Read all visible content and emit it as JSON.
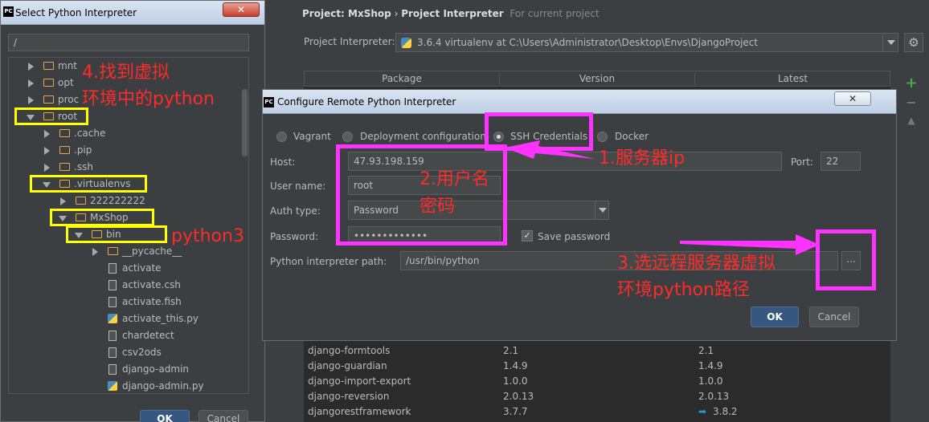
{
  "settings": {
    "breadcrumb": {
      "project": "Project: MxShop",
      "separator": "›",
      "page": "Project Interpreter",
      "scope": "For current project"
    },
    "interpreter_label": "Project Interpreter:",
    "interpreter_value": "3.6.4 virtualenv at C:\\Users\\Administrator\\Desktop\\Envs\\DjangoProject",
    "gear_icon": "⚙",
    "columns": {
      "package": "Package",
      "version": "Version",
      "latest": "Latest"
    },
    "packages": [
      {
        "name": "django-formtools",
        "version": "2.1",
        "latest": "2.1",
        "upgrade": false
      },
      {
        "name": "django-guardian",
        "version": "1.4.9",
        "latest": "1.4.9",
        "upgrade": false
      },
      {
        "name": "django-import-export",
        "version": "1.0.0",
        "latest": "1.0.0",
        "upgrade": false
      },
      {
        "name": "django-reversion",
        "version": "2.0.13",
        "latest": "2.0.13",
        "upgrade": false
      },
      {
        "name": "djangorestframework",
        "version": "3.7.7",
        "latest": "3.8.2",
        "upgrade": true
      }
    ],
    "side_buttons": {
      "add": "+",
      "remove": "−",
      "upgrade": "▲"
    }
  },
  "select_window": {
    "title": "Select Python Interpreter",
    "app_icon": "PC",
    "close": "✕",
    "path": "/",
    "tree": [
      {
        "label": "mnt",
        "type": "folder",
        "expanded": false
      },
      {
        "label": "opt",
        "type": "folder",
        "expanded": false
      },
      {
        "label": "proc",
        "type": "folder",
        "expanded": false
      },
      {
        "label": "root",
        "type": "folder",
        "expanded": true
      },
      {
        "label": ".cache",
        "type": "folder",
        "expanded": false
      },
      {
        "label": ".pip",
        "type": "folder",
        "expanded": false
      },
      {
        "label": ".ssh",
        "type": "folder",
        "expanded": false
      },
      {
        "label": ".virtualenvs",
        "type": "folder",
        "expanded": true
      },
      {
        "label": "222222222",
        "type": "folder",
        "expanded": false
      },
      {
        "label": "MxShop",
        "type": "folder",
        "expanded": true
      },
      {
        "label": "bin",
        "type": "folder",
        "expanded": true
      },
      {
        "label": "__pycache__",
        "type": "folder",
        "expanded": false
      },
      {
        "label": "activate",
        "type": "file"
      },
      {
        "label": "activate.csh",
        "type": "file"
      },
      {
        "label": "activate.fish",
        "type": "file"
      },
      {
        "label": "activate_this.py",
        "type": "py"
      },
      {
        "label": "chardetect",
        "type": "file"
      },
      {
        "label": "csv2ods",
        "type": "file"
      },
      {
        "label": "django-admin",
        "type": "file"
      },
      {
        "label": "django-admin.py",
        "type": "py"
      }
    ],
    "ok": "OK",
    "cancel": "Cancel"
  },
  "remote_dialog": {
    "title": "Configure Remote Python Interpreter",
    "app_icon": "PC",
    "close": "✕",
    "options": [
      "Vagrant",
      "Deployment configuration",
      "SSH Credentials",
      "Docker"
    ],
    "selected_option": "SSH Credentials",
    "host_label": "Host:",
    "host": "47.93.198.159",
    "port_label": "Port:",
    "port": "22",
    "username_label": "User name:",
    "username": "root",
    "auth_label": "Auth type:",
    "auth": "Password",
    "password_label": "Password:",
    "password": "•••••••••••••",
    "save_password": "Save password",
    "save_password_checked": true,
    "interpreter_path_label": "Python interpreter path:",
    "interpreter_path": "/usr/bin/python",
    "browse": "...",
    "ok": "OK",
    "cancel": "Cancel"
  },
  "annotations": {
    "step1": "1.服务器ip",
    "step2_line1": "2.用户名",
    "step2_line2": "密码",
    "step3_line1": "3.选远程服务器虚拟",
    "step3_line2": "环境python路径",
    "step4_line1": "4.找到虚拟",
    "step4_line2": "环境中的python",
    "python3": "python3",
    "box_color": "#ffff00",
    "highlight_color": "#ff33ff",
    "text_color": "#ff2a2a"
  }
}
